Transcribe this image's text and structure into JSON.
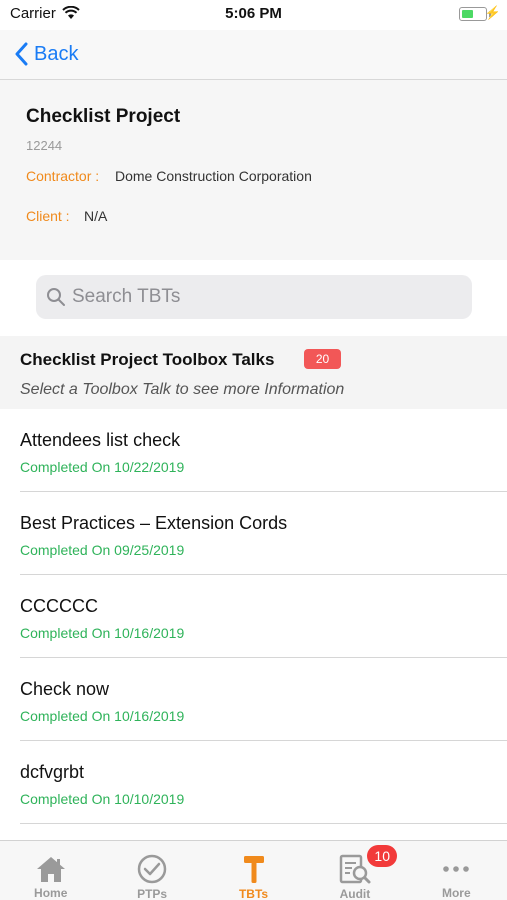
{
  "status_bar": {
    "carrier": "Carrier",
    "time": "5:06 PM",
    "battery_level": 0.5
  },
  "nav": {
    "back_label": "Back"
  },
  "project": {
    "title": "Checklist Project",
    "id": "12244",
    "contractor_label": "Contractor :",
    "contractor_value": "Dome Construction Corporation",
    "client_label": "Client :",
    "client_value": "N/A"
  },
  "search": {
    "placeholder": "Search TBTs"
  },
  "section": {
    "title": "Checklist Project Toolbox Talks",
    "count": "20",
    "subtitle": "Select a Toolbox Talk to see more Information"
  },
  "talks": [
    {
      "title": "Attendees list check",
      "status": "Completed On 10/22/2019"
    },
    {
      "title": "Best Practices – Extension Cords",
      "status": "Completed On 09/25/2019"
    },
    {
      "title": "CCCCCC",
      "status": "Completed On 10/16/2019"
    },
    {
      "title": "Check now",
      "status": "Completed On 10/16/2019"
    },
    {
      "title": "dcfvgrbt",
      "status": "Completed On 10/10/2019"
    }
  ],
  "tabs": [
    {
      "label": "Home",
      "icon": "home-icon"
    },
    {
      "label": "PTPs",
      "icon": "check-circle-icon"
    },
    {
      "label": "TBTs",
      "icon": "hammer-icon"
    },
    {
      "label": "Audit",
      "icon": "audit-icon",
      "badge": "10"
    },
    {
      "label": "More",
      "icon": "more-icon"
    }
  ],
  "colors": {
    "accent": "#f08a1c",
    "link": "#1a7cf5",
    "success": "#2fb35a",
    "badge": "#f25757"
  }
}
